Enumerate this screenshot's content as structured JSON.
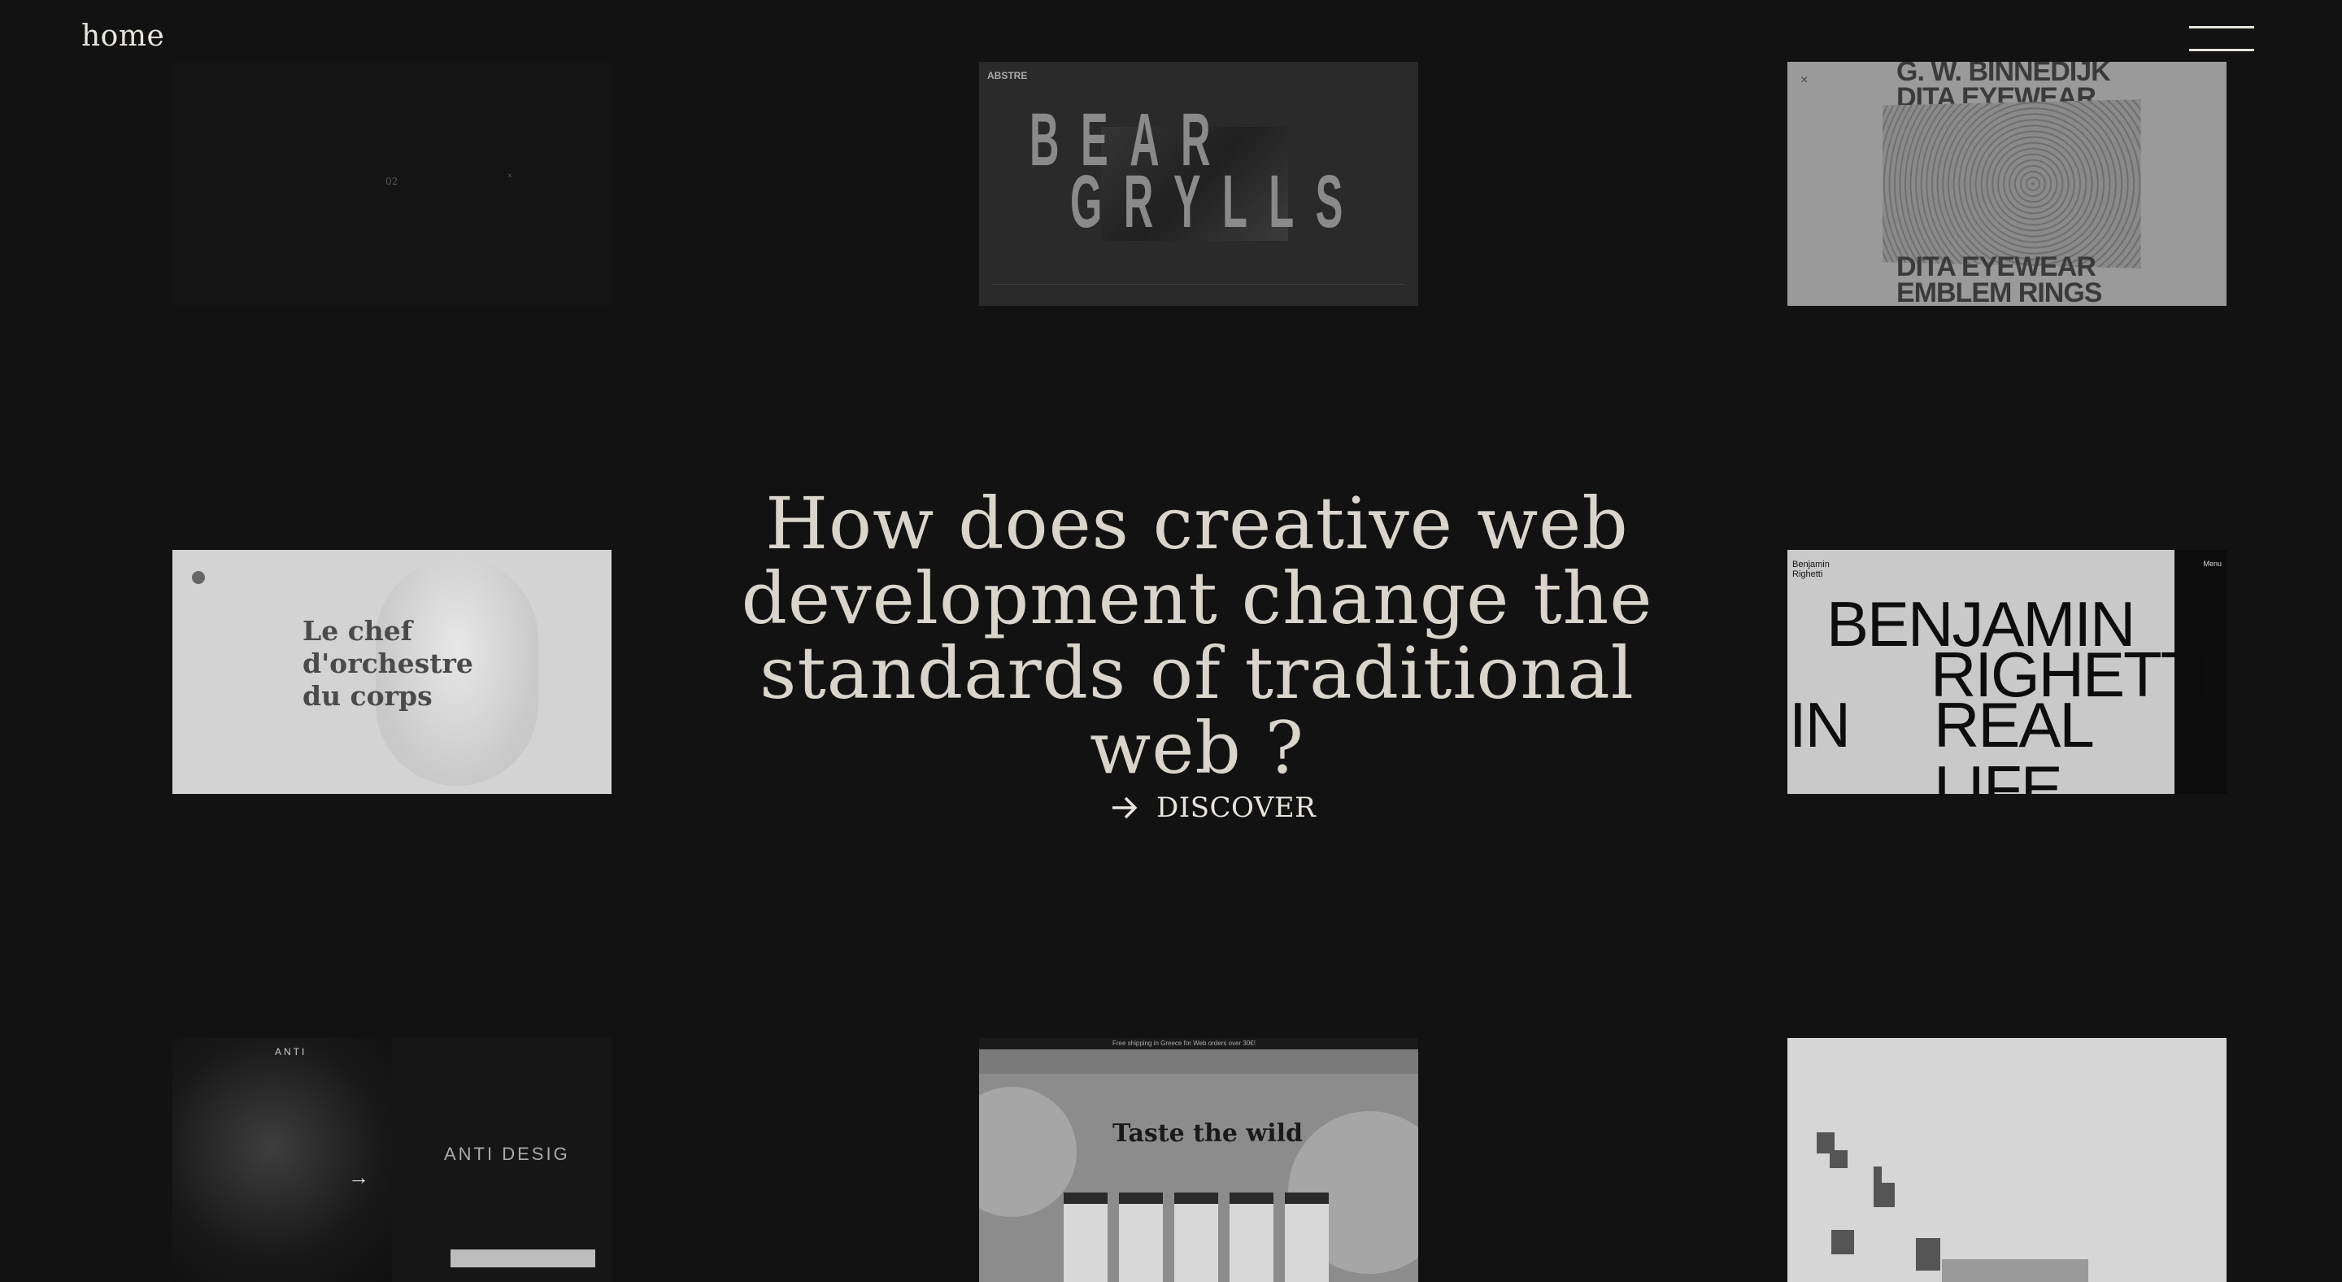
{
  "header": {
    "logo_text": "home",
    "menu_icon": "hamburger-menu-icon"
  },
  "hero": {
    "headline": "How does creative web development change the standards of traditional web ?",
    "cta_label": "DISCOVER",
    "cta_icon": "arrow-right-icon"
  },
  "thumbnails": {
    "dark": {
      "number": "02",
      "mark": "×"
    },
    "bear_grylls": {
      "brand": "ABSTRE",
      "line1": "BEAR",
      "line2": "GRYLLS"
    },
    "dita": {
      "line1": "G. W. BINNEDIJK",
      "line2": "DITA EYEWEAR",
      "line3": "DITA EYEWEAR",
      "line4": "EMBLEM RINGS",
      "close": "×"
    },
    "chef": {
      "title_line1": "Le chef",
      "title_line2": "d'orchestre",
      "title_line3": "du corps"
    },
    "benjamin": {
      "small_line1": "Benjamin",
      "small_line2": "Righetti",
      "menu": "Menu",
      "line1": "BENJAMIN",
      "line2": "RIGHETTI",
      "line3a": "IN",
      "line3b": "REAL LIFE"
    },
    "anti": {
      "brand": "ANTI",
      "title": "ANTI DESIG",
      "arrow": "→"
    },
    "taste": {
      "tagline": "Free shipping in Greece for Web orders over 30€!",
      "headline": "Taste the wild"
    }
  },
  "colors": {
    "background": "#121212",
    "text": "#d9d4cc"
  }
}
